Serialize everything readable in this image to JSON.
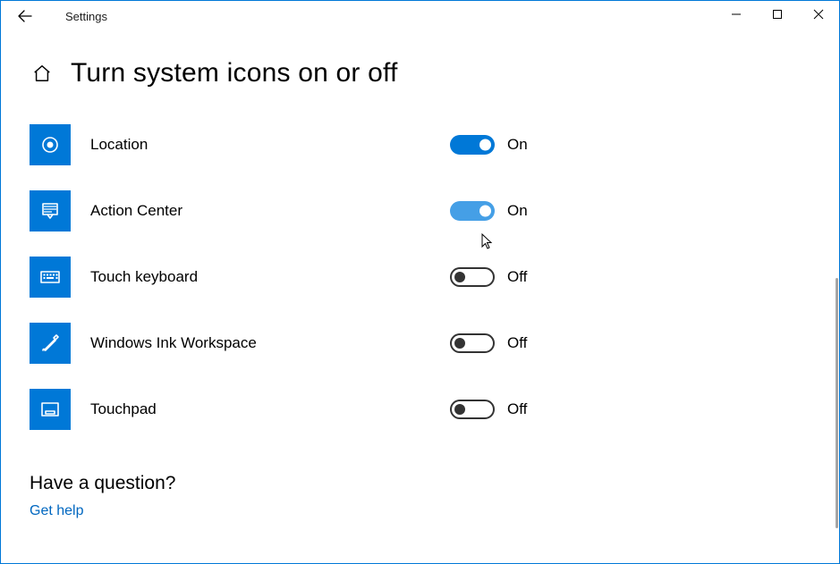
{
  "titlebar": {
    "title": "Settings"
  },
  "page": {
    "title": "Turn system icons on or off"
  },
  "items": [
    {
      "label": "Location",
      "on": true,
      "state": "On",
      "hover": false,
      "icon": "location"
    },
    {
      "label": "Action Center",
      "on": true,
      "state": "On",
      "hover": true,
      "icon": "action-center"
    },
    {
      "label": "Touch keyboard",
      "on": false,
      "state": "Off",
      "hover": false,
      "icon": "touch-keyboard"
    },
    {
      "label": "Windows Ink Workspace",
      "on": false,
      "state": "Off",
      "hover": false,
      "icon": "ink"
    },
    {
      "label": "Touchpad",
      "on": false,
      "state": "Off",
      "hover": false,
      "icon": "touchpad"
    }
  ],
  "footer": {
    "question": "Have a question?",
    "help": "Get help"
  }
}
